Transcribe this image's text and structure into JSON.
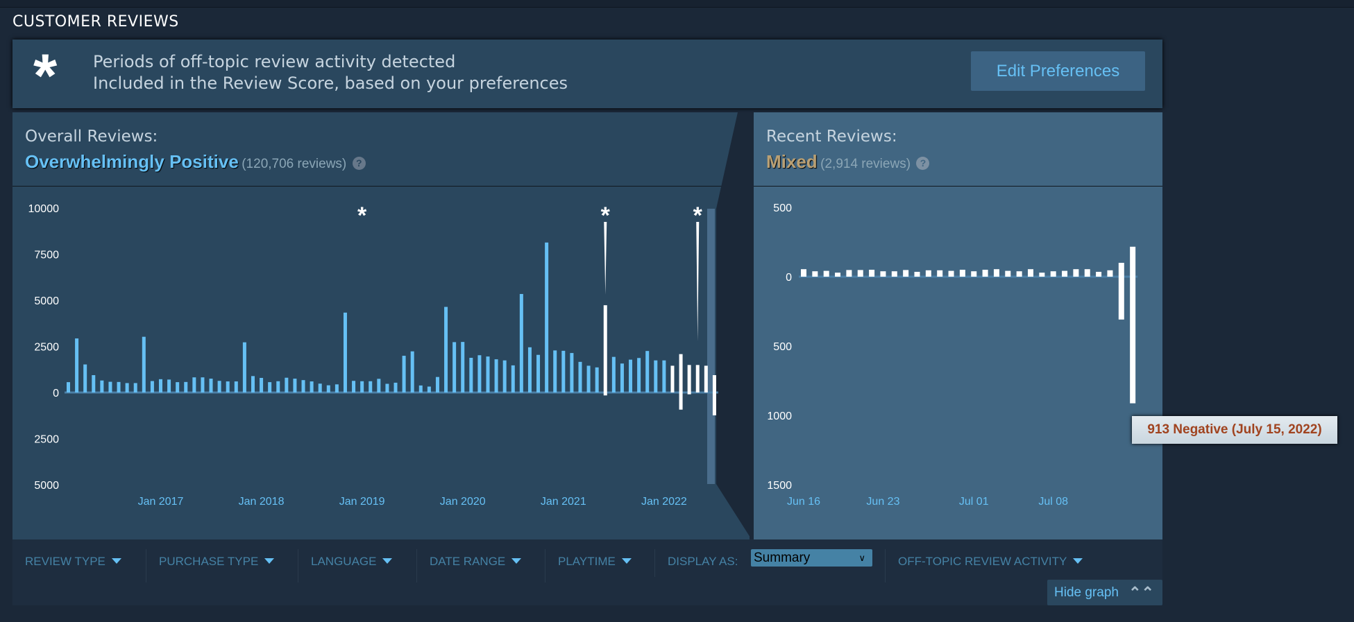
{
  "section_title": "CUSTOMER REVIEWS",
  "banner": {
    "icon": "asterisk-icon",
    "line1": "Periods of off-topic review activity detected",
    "line2": "Included in the Review Score, based on your preferences",
    "button": "Edit Preferences"
  },
  "overall": {
    "heading": "Overall Reviews:",
    "score": "Overwhelmingly Positive",
    "count": "(120,706 reviews)",
    "help": "?",
    "score_color": "#66c0f4"
  },
  "recent": {
    "heading": "Recent Reviews:",
    "score": "Mixed",
    "count": "(2,914 reviews)",
    "help": "?",
    "score_color": "#b9a074"
  },
  "tooltip": "913 Negative (July 15, 2022)",
  "filters": {
    "review_type": "REVIEW TYPE",
    "purchase_type": "PURCHASE TYPE",
    "language": "LANGUAGE",
    "date_range": "DATE RANGE",
    "playtime": "PLAYTIME",
    "display_as": "DISPLAY AS:",
    "display_value": "Summary",
    "off_topic": "OFF-TOPIC REVIEW ACTIVITY",
    "hide_graph": "Hide graph"
  },
  "colors": {
    "positive": "#66c0f4",
    "highlight": "#ffffff",
    "page_bg": "#1b2838",
    "panel": "#2a475e",
    "panel_recent": "#416682"
  },
  "chart_data": [
    {
      "type": "bar",
      "title": "",
      "ylim": [
        -5000,
        10000
      ],
      "y_ticks": [
        "10000",
        "7500",
        "5000",
        "2500",
        "0",
        "2500",
        "5000"
      ],
      "y_tick_values": [
        10000,
        7500,
        5000,
        2500,
        0,
        -2500,
        -5000
      ],
      "x_tick_labels": [
        "Jan 2017",
        "Jan 2018",
        "Jan 2019",
        "Jan 2020",
        "Jan 2021",
        "Jan 2022"
      ],
      "x": [
        "2016-02",
        "2016-03",
        "2016-04",
        "2016-05",
        "2016-06",
        "2016-07",
        "2016-08",
        "2016-09",
        "2016-10",
        "2016-11",
        "2016-12",
        "2017-01",
        "2017-02",
        "2017-03",
        "2017-04",
        "2017-05",
        "2017-06",
        "2017-07",
        "2017-08",
        "2017-09",
        "2017-10",
        "2017-11",
        "2017-12",
        "2018-01",
        "2018-02",
        "2018-03",
        "2018-04",
        "2018-05",
        "2018-06",
        "2018-07",
        "2018-08",
        "2018-09",
        "2018-10",
        "2018-11",
        "2018-12",
        "2019-01",
        "2019-02",
        "2019-03",
        "2019-04",
        "2019-05",
        "2019-06",
        "2019-07",
        "2019-08",
        "2019-09",
        "2019-10",
        "2019-11",
        "2019-12",
        "2020-01",
        "2020-02",
        "2020-03",
        "2020-04",
        "2020-05",
        "2020-06",
        "2020-07",
        "2020-08",
        "2020-09",
        "2020-10",
        "2020-11",
        "2020-12",
        "2021-01",
        "2021-02",
        "2021-03",
        "2021-04",
        "2021-05",
        "2021-06",
        "2021-07",
        "2021-08",
        "2021-09",
        "2021-10",
        "2021-11",
        "2021-12",
        "2022-01",
        "2022-02",
        "2022-03",
        "2022-04",
        "2022-05",
        "2022-06",
        "2022-07"
      ],
      "series": [
        {
          "values": [
            560,
            2930,
            1520,
            940,
            650,
            580,
            570,
            510,
            510,
            3020,
            620,
            720,
            700,
            560,
            570,
            820,
            820,
            750,
            630,
            600,
            600,
            2720,
            890,
            790,
            560,
            610,
            800,
            750,
            670,
            600,
            480,
            390,
            440,
            4330,
            630,
            610,
            610,
            740,
            470,
            530,
            1990,
            2230,
            380,
            320,
            840,
            4640,
            2730,
            2740,
            1880,
            2020,
            1950,
            1800,
            1740,
            1470,
            5340,
            2450,
            2040,
            8130,
            2280,
            2260,
            2140,
            1660,
            1450,
            1360,
            4730,
            1930,
            1570,
            1780,
            1870,
            2250,
            1740,
            1740,
            1450,
            2080,
            1490,
            1490,
            1450,
            940
          ]
        },
        {
          "values": [
            0,
            0,
            0,
            0,
            0,
            0,
            0,
            0,
            0,
            0,
            0,
            0,
            0,
            0,
            0,
            0,
            0,
            0,
            0,
            0,
            0,
            0,
            0,
            0,
            0,
            0,
            0,
            0,
            0,
            0,
            0,
            0,
            0,
            0,
            0,
            0,
            0,
            0,
            0,
            0,
            0,
            0,
            0,
            0,
            0,
            0,
            0,
            0,
            0,
            0,
            0,
            0,
            0,
            0,
            0,
            0,
            0,
            0,
            0,
            0,
            0,
            0,
            0,
            0,
            -160,
            0,
            0,
            0,
            0,
            0,
            0,
            0,
            0,
            -930,
            -100,
            0,
            0,
            -1240
          ]
        }
      ],
      "highlighted": [
        "2021-06",
        "2022-02",
        "2022-03",
        "2022-04",
        "2022-05",
        "2022-06",
        "2022-07"
      ],
      "off_topic_marks": [
        "2019-01",
        "2021-06",
        "2022-05"
      ],
      "off_topic_symbol": "*"
    },
    {
      "type": "bar",
      "title": "",
      "ylim": [
        -1500,
        500
      ],
      "y_ticks": [
        "500",
        "0",
        "500",
        "1000",
        "1500"
      ],
      "y_tick_values": [
        500,
        0,
        -500,
        -1000,
        -1500
      ],
      "x_tick_labels": [
        "Jun 16",
        "Jun 23",
        "Jul 01",
        "Jul 08"
      ],
      "x": [
        "2022-06-16",
        "2022-06-17",
        "2022-06-18",
        "2022-06-19",
        "2022-06-20",
        "2022-06-21",
        "2022-06-22",
        "2022-06-23",
        "2022-06-24",
        "2022-06-25",
        "2022-06-26",
        "2022-06-27",
        "2022-06-28",
        "2022-06-29",
        "2022-06-30",
        "2022-07-01",
        "2022-07-02",
        "2022-07-03",
        "2022-07-04",
        "2022-07-05",
        "2022-07-06",
        "2022-07-07",
        "2022-07-08",
        "2022-07-09",
        "2022-07-10",
        "2022-07-11",
        "2022-07-12",
        "2022-07-13",
        "2022-07-14",
        "2022-07-15"
      ],
      "series": [
        {
          "values": [
            54,
            39,
            42,
            29,
            48,
            48,
            50,
            39,
            39,
            48,
            35,
            46,
            46,
            42,
            50,
            39,
            50,
            54,
            42,
            39,
            54,
            29,
            39,
            42,
            54,
            54,
            35,
            46,
            100,
            216
          ]
        },
        {
          "values": [
            0,
            0,
            0,
            0,
            0,
            0,
            0,
            0,
            0,
            0,
            0,
            0,
            0,
            0,
            0,
            0,
            0,
            0,
            0,
            0,
            0,
            0,
            0,
            0,
            0,
            0,
            0,
            0,
            -309,
            -913
          ]
        }
      ]
    }
  ]
}
